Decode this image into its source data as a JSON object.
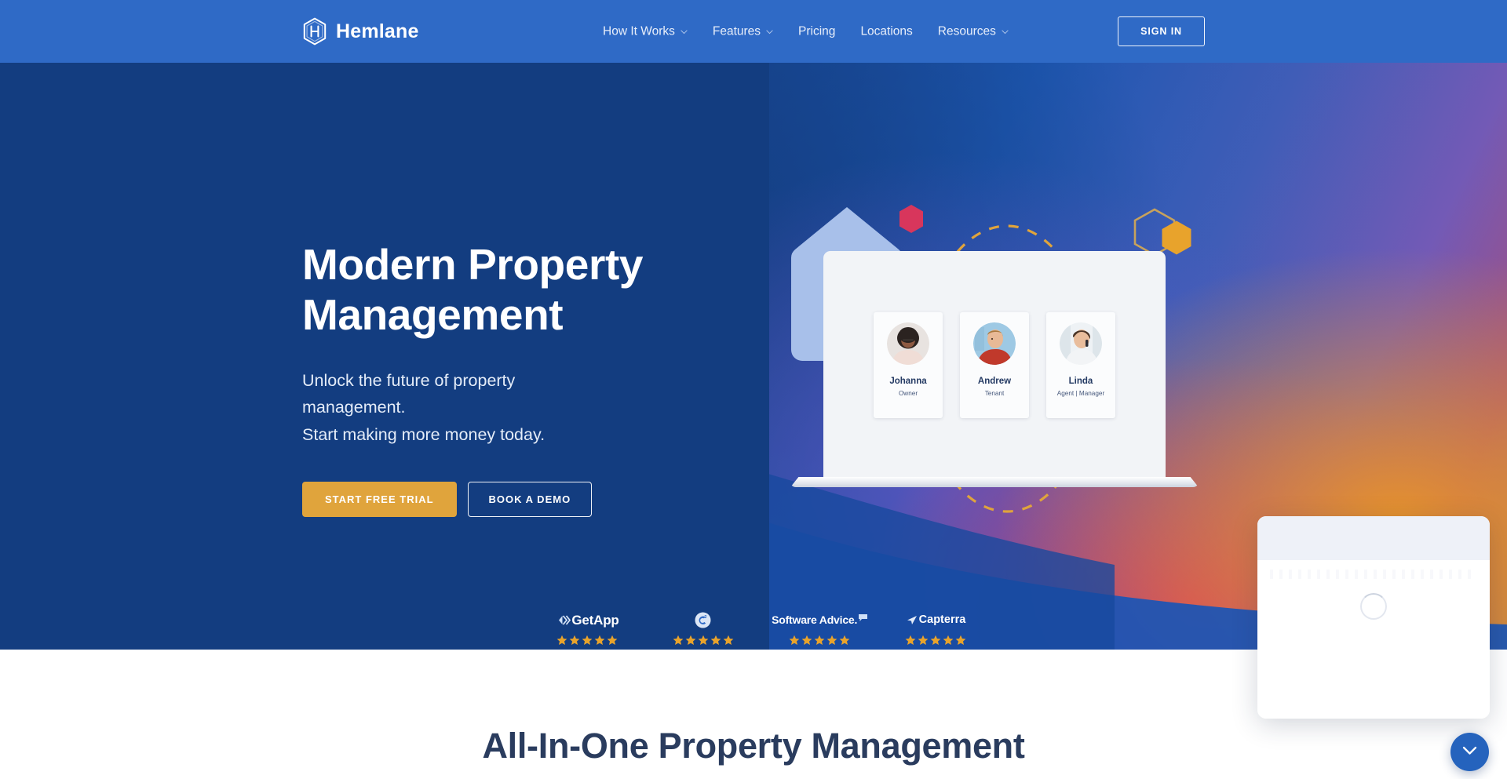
{
  "brand": {
    "name": "Hemlane",
    "logo_icon": "hexagon-h-logo"
  },
  "nav": {
    "items": [
      {
        "label": "How It Works",
        "has_dropdown": true
      },
      {
        "label": "Features",
        "has_dropdown": true
      },
      {
        "label": "Pricing",
        "has_dropdown": false
      },
      {
        "label": "Locations",
        "has_dropdown": false
      },
      {
        "label": "Resources",
        "has_dropdown": true
      }
    ],
    "signin_label": "SIGN IN",
    "background_color": "#2f6ac6"
  },
  "hero": {
    "title_line1": "Modern Property",
    "title_line2": "Management",
    "subtitle_line1": "Unlock the future of property",
    "subtitle_line2": "management.",
    "subtitle_line3": "Start making more money today.",
    "primary_cta": "START FREE TRIAL",
    "secondary_cta": "BOOK A DEMO",
    "background_color": "#133d80",
    "primary_cta_color": "#e0a43c",
    "personas": [
      {
        "name": "Johanna",
        "role": "Owner"
      },
      {
        "name": "Andrew",
        "role": "Tenant"
      },
      {
        "name": "Linda",
        "role": "Agent | Manager"
      }
    ],
    "decorations": [
      {
        "icon": "house-shape",
        "color": "#a8c0ea"
      },
      {
        "icon": "hexagon-filled",
        "color": "#d8365c"
      },
      {
        "icon": "hexagon-outline",
        "color": "#c7a25c"
      },
      {
        "icon": "hexagon-filled",
        "color": "#e8a32c"
      },
      {
        "icon": "dashed-circle",
        "color": "#e0a43c"
      }
    ]
  },
  "review_badges": [
    {
      "name": "GetApp",
      "logo_icon": "getapp-logo",
      "stars": 5
    },
    {
      "name": "G2",
      "logo_icon": "g2-logo",
      "stars": 5
    },
    {
      "name": "Software Advice.",
      "logo_icon": "software-advice-logo",
      "stars": 5
    },
    {
      "name": "Capterra",
      "logo_icon": "capterra-logo",
      "stars": 5
    }
  ],
  "star_color": "#e8a32c",
  "section": {
    "title": "All-In-One Property Management"
  },
  "chat": {
    "state": "loading",
    "spinner_icon": "loading-spinner",
    "toggle_icon": "chevron-down-icon",
    "toggle_color": "#2563bd"
  }
}
